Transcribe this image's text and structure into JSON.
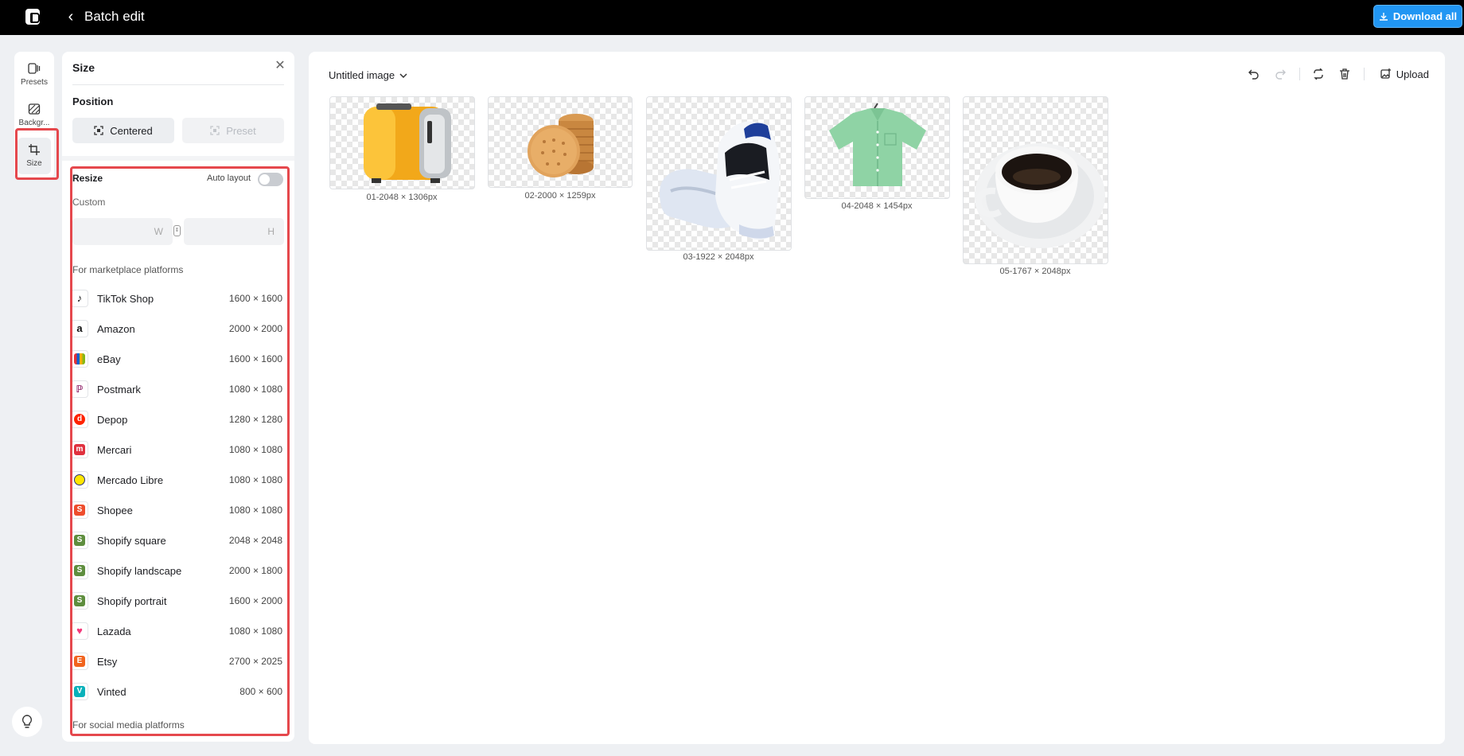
{
  "header": {
    "title": "Batch edit",
    "download_label": "Download all"
  },
  "rail": [
    {
      "label": "Presets"
    },
    {
      "label": "Backgr..."
    },
    {
      "label": "Size"
    }
  ],
  "panel": {
    "title": "Size",
    "position_label": "Position",
    "centered_label": "Centered",
    "preset_label": "Preset",
    "resize_label": "Resize",
    "auto_layout_label": "Auto layout",
    "custom_label": "Custom",
    "width_placeholder": "W",
    "height_placeholder": "H",
    "marketplace_label": "For marketplace platforms",
    "social_label": "For social media platforms",
    "platforms": [
      {
        "name": "TikTok Shop",
        "size": "1600 × 1600",
        "icon": "tiktok-icon",
        "color": "#000000"
      },
      {
        "name": "Amazon",
        "size": "2000 × 2000",
        "icon": "amazon-icon",
        "color": "#ff9900"
      },
      {
        "name": "eBay",
        "size": "1600 × 1600",
        "icon": "ebay-icon",
        "color": "#3665f3"
      },
      {
        "name": "Postmark",
        "size": "1080 × 1080",
        "icon": "poshmark-icon",
        "color": "#7f0353"
      },
      {
        "name": "Depop",
        "size": "1280 × 1280",
        "icon": "depop-icon",
        "color": "#ff2300"
      },
      {
        "name": "Mercari",
        "size": "1080 × 1080",
        "icon": "mercari-icon",
        "color": "#e0313f"
      },
      {
        "name": "Mercado Libre",
        "size": "1080 × 1080",
        "icon": "mercado-libre-icon",
        "color": "#ffe600"
      },
      {
        "name": "Shopee",
        "size": "1080 × 1080",
        "icon": "shopee-icon",
        "color": "#ee4d2d"
      },
      {
        "name": "Shopify square",
        "size": "2048 × 2048",
        "icon": "shopify-icon",
        "color": "#5e8e3e"
      },
      {
        "name": "Shopify landscape",
        "size": "2000 × 1800",
        "icon": "shopify-icon",
        "color": "#5e8e3e"
      },
      {
        "name": "Shopify portrait",
        "size": "1600 × 2000",
        "icon": "shopify-icon",
        "color": "#5e8e3e"
      },
      {
        "name": "Lazada",
        "size": "1080 × 1080",
        "icon": "lazada-icon",
        "color": "#f3387a"
      },
      {
        "name": "Etsy",
        "size": "2700 × 2025",
        "icon": "etsy-icon",
        "color": "#f1641e"
      },
      {
        "name": "Vinted",
        "size": "800 × 600",
        "icon": "vinted-icon",
        "color": "#09b1ba"
      }
    ]
  },
  "canvas": {
    "doc_name": "Untitled image",
    "upload_label": "Upload",
    "images": [
      {
        "caption": "01-2048 × 1306px",
        "subject": "yellow toaster"
      },
      {
        "caption": "02-2000 × 1259px",
        "subject": "stack of crackers"
      },
      {
        "caption": "03-1922 × 2048px",
        "subject": "white sneaker"
      },
      {
        "caption": "04-2048 × 1454px",
        "subject": "green shirt"
      },
      {
        "caption": "05-1767 × 2048px",
        "subject": "coffee cup"
      }
    ]
  }
}
